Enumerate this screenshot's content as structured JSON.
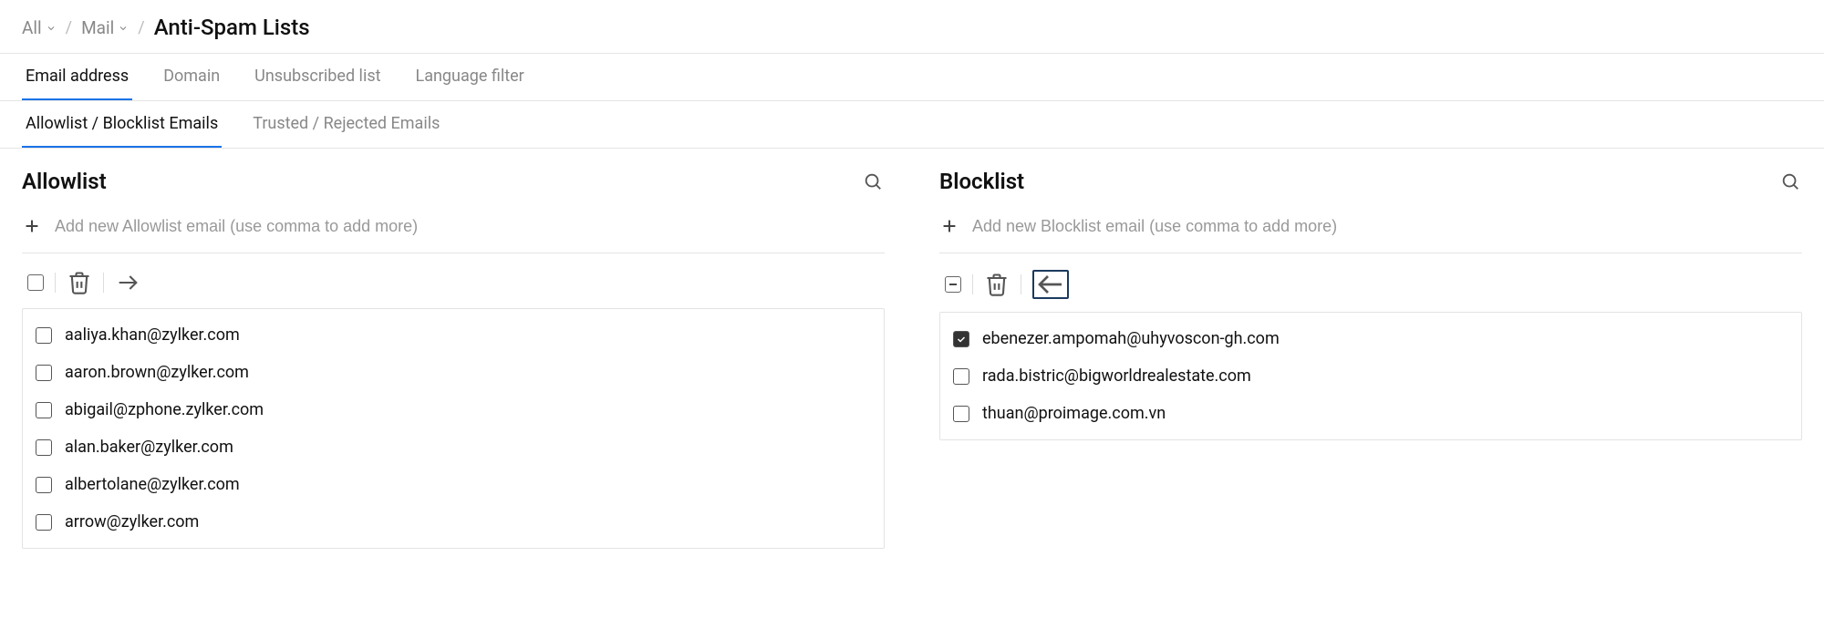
{
  "breadcrumb": {
    "items": [
      {
        "label": "All"
      },
      {
        "label": "Mail"
      }
    ],
    "title": "Anti-Spam Lists"
  },
  "tabs_primary": [
    {
      "label": "Email address",
      "active": true
    },
    {
      "label": "Domain",
      "active": false
    },
    {
      "label": "Unsubscribed list",
      "active": false
    },
    {
      "label": "Language filter",
      "active": false
    }
  ],
  "tabs_secondary": [
    {
      "label": "Allowlist / Blocklist Emails",
      "active": true
    },
    {
      "label": "Trusted / Rejected Emails",
      "active": false
    }
  ],
  "allowlist": {
    "title": "Allowlist",
    "add_placeholder": "Add new Allowlist email (use comma to add more)",
    "select_all_state": "unchecked",
    "items": [
      {
        "email": "aaliya.khan@zylker.com",
        "checked": false
      },
      {
        "email": "aaron.brown@zylker.com",
        "checked": false
      },
      {
        "email": "abigail@zphone.zylker.com",
        "checked": false
      },
      {
        "email": "alan.baker@zylker.com",
        "checked": false
      },
      {
        "email": "albertolane@zylker.com",
        "checked": false
      },
      {
        "email": "arrow@zylker.com",
        "checked": false
      }
    ]
  },
  "blocklist": {
    "title": "Blocklist",
    "add_placeholder": "Add new Blocklist email (use comma to add more)",
    "select_all_state": "partial",
    "items": [
      {
        "email": "ebenezer.ampomah@uhyvoscon-gh.com",
        "checked": true
      },
      {
        "email": "rada.bistric@bigworldrealestate.com",
        "checked": false
      },
      {
        "email": "thuan@proimage.com.vn",
        "checked": false
      }
    ]
  }
}
